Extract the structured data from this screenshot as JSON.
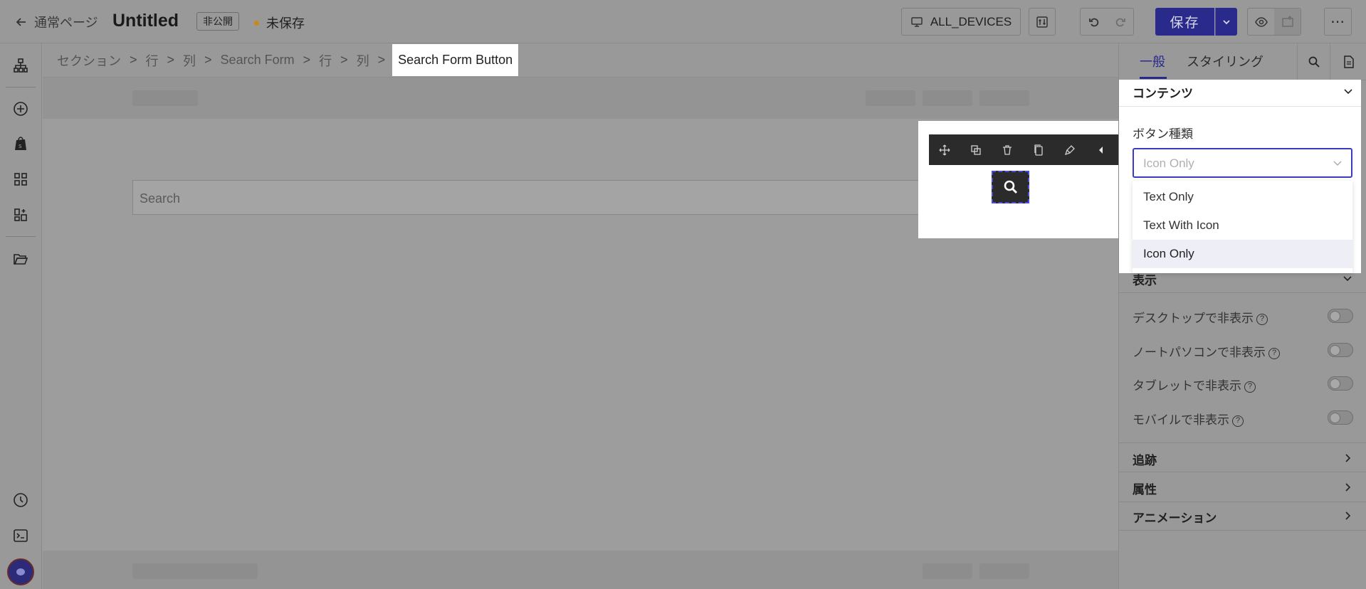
{
  "header": {
    "back_label": "通常ページ",
    "page_title": "Untitled",
    "visibility_badge": "非公開",
    "save_status": "未保存",
    "devices_label": "ALL_DEVICES",
    "save_label": "保存",
    "more_label": "⋯"
  },
  "rail": {
    "icons": [
      "sitemap-icon",
      "add-circle-icon",
      "shopify-bag-icon",
      "grid-icon",
      "widgets-icon",
      "folder-open-icon",
      "history-icon",
      "terminal-icon"
    ]
  },
  "breadcrumb": {
    "items": [
      "セクション",
      "行",
      "列",
      "Search Form",
      "行",
      "列"
    ],
    "active": "Search Form Button",
    "separator": ">"
  },
  "canvas": {
    "search_placeholder": "Search"
  },
  "right_panel": {
    "tabs": [
      "一般",
      "スタイリング"
    ],
    "active_tab": "一般",
    "content_section": {
      "title": "コンテンツ",
      "field_label": "ボタン種類",
      "select_value": "Icon Only",
      "options": [
        "Text Only",
        "Text With Icon",
        "Icon Only"
      ],
      "selected_option": "Icon Only"
    },
    "display_section": {
      "title": "表示",
      "toggles": [
        {
          "label": "デスクトップで非表示",
          "on": false
        },
        {
          "label": "ノートパソコンで非表示",
          "on": false
        },
        {
          "label": "タブレットで非表示",
          "on": false
        },
        {
          "label": "モバイルで非表示",
          "on": false
        }
      ]
    },
    "collapsed_sections": [
      "追跡",
      "属性",
      "アニメーション"
    ]
  },
  "colors": {
    "accent": "#2a2a8c",
    "unsaved_dot": "#c88a18",
    "overlay_gray": "#999999"
  }
}
